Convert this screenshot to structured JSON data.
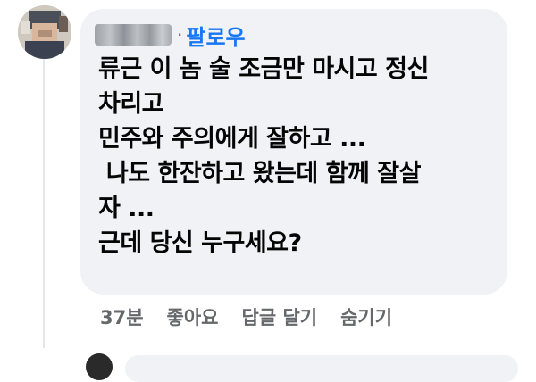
{
  "comment": {
    "follow_label": "팔로우",
    "separator": "·",
    "lines": [
      "류근 이 놈 술 조금만 마시고 정신",
      "차리고",
      "민주와 주의에게 잘하고 ...",
      " 나도 한잔하고 왔는데 함께 잘살",
      "자 ...",
      "근데 당신 누구세요?"
    ]
  },
  "actions": {
    "time": "37분",
    "like": "좋아요",
    "reply": "답글 달기",
    "hide": "숨기기"
  },
  "colors": {
    "bubble": "#f0f2f5",
    "link": "#1877f2",
    "meta": "#65676b",
    "text": "#050505"
  }
}
